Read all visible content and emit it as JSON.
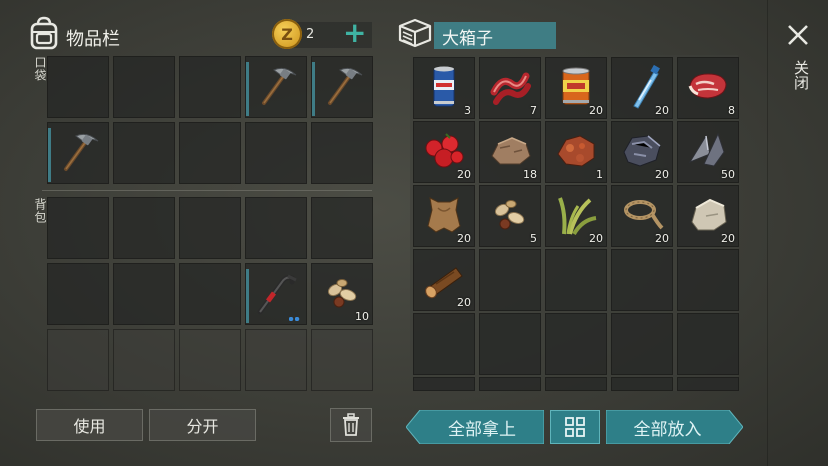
{
  "header": {
    "inventory_title": "物品栏",
    "coin_count": "2",
    "coin_symbol": "Z",
    "add_symbol": "+",
    "container_title": "大箱子",
    "close_label": "关闭"
  },
  "inventory": {
    "pocket_label": "口袋",
    "backpack_label": "背包",
    "pocket_items": [
      {
        "slot": 3,
        "icon": "pickaxe-icon",
        "count": ""
      },
      {
        "slot": 4,
        "icon": "pickaxe-icon",
        "count": ""
      },
      {
        "slot": 5,
        "icon": "pickaxe-icon",
        "count": ""
      }
    ],
    "backpack_items": [
      {
        "slot": 8,
        "icon": "crowbar-icon",
        "count": ""
      },
      {
        "slot": 9,
        "icon": "nuts-seeds-icon",
        "count": "10"
      }
    ]
  },
  "chest": {
    "items": [
      {
        "icon": "soda-can-icon",
        "count": "3"
      },
      {
        "icon": "raw-bacon-icon",
        "count": "7"
      },
      {
        "icon": "canned-food-icon",
        "count": "20"
      },
      {
        "icon": "water-bottle-icon",
        "count": "20"
      },
      {
        "icon": "raw-meat-steak-icon",
        "count": "8"
      },
      {
        "icon": "red-berries-icon",
        "count": "20"
      },
      {
        "icon": "stone-ore-icon",
        "count": "18"
      },
      {
        "icon": "copper-ore-icon",
        "count": "1"
      },
      {
        "icon": "iron-ore-icon",
        "count": "20"
      },
      {
        "icon": "metal-scrap-icon",
        "count": "50"
      },
      {
        "icon": "leather-hide-icon",
        "count": "20"
      },
      {
        "icon": "seeds-icon",
        "count": "5"
      },
      {
        "icon": "plant-fiber-icon",
        "count": "20"
      },
      {
        "icon": "rope-icon",
        "count": "20"
      },
      {
        "icon": "stone-chunk-icon",
        "count": "20"
      },
      {
        "icon": "wood-log-icon",
        "count": "20"
      }
    ]
  },
  "buttons": {
    "use": "使用",
    "split": "分开",
    "take_all": "全部拿上",
    "put_all": "全部放入"
  },
  "colors": {
    "teal_button": "#2e7f88",
    "title_bar": "#3f7d84",
    "durability": "#3f7c86",
    "coin": "#d8a224",
    "plus": "#3fb3a3"
  }
}
